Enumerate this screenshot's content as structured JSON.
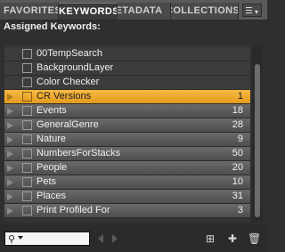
{
  "tabs": [
    {
      "label": "FAVORITES",
      "active": false
    },
    {
      "label": "KEYWORDS",
      "active": true
    },
    {
      "label": "METADATA",
      "active": false
    },
    {
      "label": "COLLECTIONS",
      "active": false
    }
  ],
  "panel_menu": {
    "icon": "panel-menu-icon"
  },
  "assigned_label": "Assigned Keywords:",
  "keywords": [
    {
      "name": "00TempSearch",
      "count": "",
      "style": "plain",
      "expandable": false
    },
    {
      "name": "BackgroundLayer",
      "count": "",
      "style": "plain",
      "expandable": false
    },
    {
      "name": "Color Checker",
      "count": "",
      "style": "plain",
      "expandable": false
    },
    {
      "name": "CR Versions",
      "count": "1",
      "style": "selected",
      "expandable": true
    },
    {
      "name": "Events",
      "count": "18",
      "style": "group",
      "expandable": true
    },
    {
      "name": "GeneralGenre",
      "count": "28",
      "style": "group",
      "expandable": true
    },
    {
      "name": "Nature",
      "count": "9",
      "style": "group",
      "expandable": true
    },
    {
      "name": "NumbersForStacks",
      "count": "50",
      "style": "group",
      "expandable": true
    },
    {
      "name": "People",
      "count": "20",
      "style": "group",
      "expandable": true
    },
    {
      "name": "Pets",
      "count": "10",
      "style": "group",
      "expandable": true
    },
    {
      "name": "Places",
      "count": "31",
      "style": "group",
      "expandable": true
    },
    {
      "name": "Print Profiled For",
      "count": "3",
      "style": "group",
      "expandable": true
    }
  ],
  "bottom": {
    "search_placeholder": "",
    "icons": [
      "search-icon",
      "prev-arrow-icon",
      "next-arrow-icon",
      "new-sub-keyword-icon",
      "new-keyword-icon",
      "trash-icon"
    ]
  },
  "colors": {
    "selected": "#f0a830",
    "panel": "#2f2f2f"
  }
}
